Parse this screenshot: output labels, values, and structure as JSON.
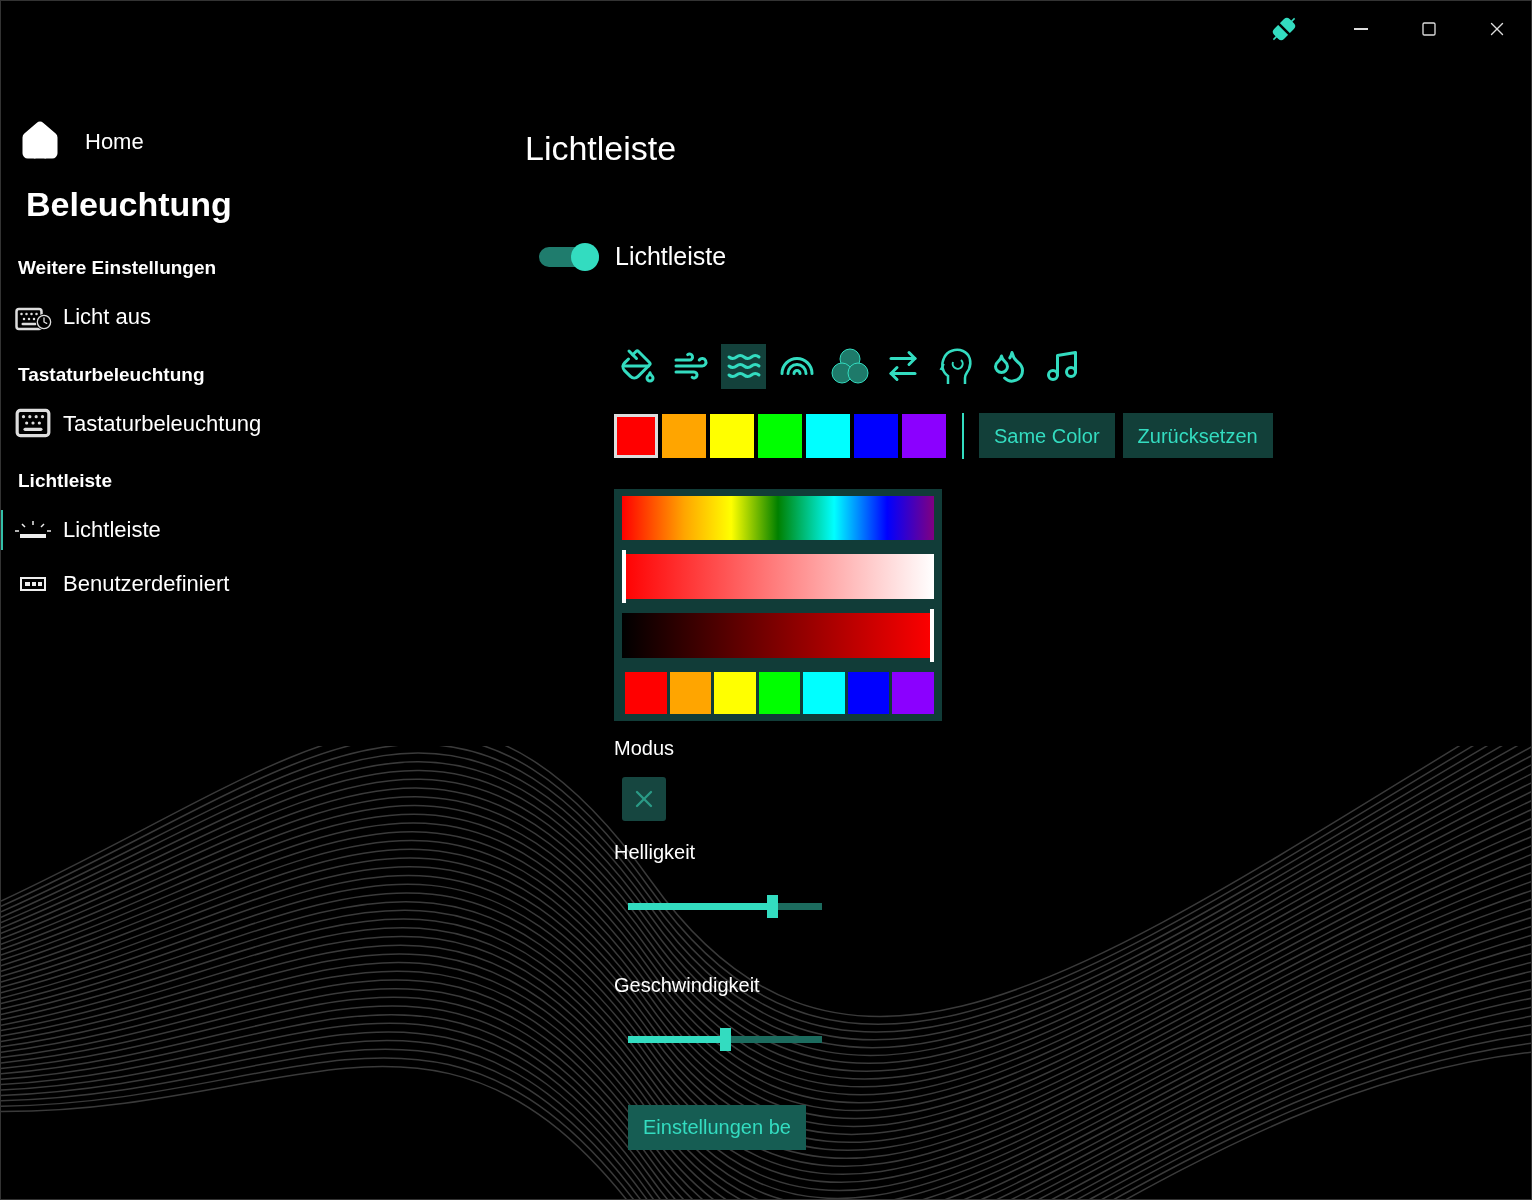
{
  "nav": {
    "home": "Home",
    "title": "Beleuchtung",
    "sections": [
      {
        "heading": "Weitere Einstellungen",
        "items": [
          {
            "label": "Licht aus",
            "kind": "timer",
            "selected": false
          }
        ]
      },
      {
        "heading": "Tastaturbeleuchtung",
        "items": [
          {
            "label": "Tastaturbeleuchtung",
            "kind": "keyboard",
            "selected": false
          }
        ]
      },
      {
        "heading": "Lichtleiste",
        "items": [
          {
            "label": "Lichtleiste",
            "kind": "lightbar",
            "selected": true
          },
          {
            "label": "Benutzerdefiniert",
            "kind": "custom",
            "selected": false
          }
        ]
      }
    ]
  },
  "page": {
    "title": "Lichtleiste",
    "toggle": {
      "label": "Lichtleiste",
      "on": true
    },
    "effects": [
      {
        "kind": "bucket",
        "selected": false
      },
      {
        "kind": "wind",
        "selected": false
      },
      {
        "kind": "wave",
        "selected": true
      },
      {
        "kind": "rainbow",
        "selected": false
      },
      {
        "kind": "circles",
        "selected": false
      },
      {
        "kind": "swap",
        "selected": false
      },
      {
        "kind": "head",
        "selected": false
      },
      {
        "kind": "drops",
        "selected": false
      },
      {
        "kind": "music",
        "selected": false
      }
    ],
    "swatches": [
      {
        "color": "#ff0000",
        "selected": true
      },
      {
        "color": "#ffa500",
        "selected": false
      },
      {
        "color": "#ffff00",
        "selected": false
      },
      {
        "color": "#00ff00",
        "selected": false
      },
      {
        "color": "#00ffff",
        "selected": false
      },
      {
        "color": "#0000ff",
        "selected": false
      },
      {
        "color": "#8b00ff",
        "selected": false
      }
    ],
    "buttons": [
      "Same Color",
      "Zurücksetzen"
    ],
    "picker": {
      "saturation": {
        "level": 0
      },
      "brightness": {
        "level": 1
      },
      "swatches": [
        {
          "color": "#ff0000"
        },
        {
          "color": "#ffa500"
        },
        {
          "color": "#ffff00"
        },
        {
          "color": "#00ff00"
        },
        {
          "color": "#00ffff"
        },
        {
          "color": "#0000ff"
        },
        {
          "color": "#8b00ff"
        }
      ]
    },
    "mode": {
      "label": "Modus"
    },
    "sliders": [
      {
        "label": "Helligkeit",
        "level": 0.74
      },
      {
        "label": "Geschwindigkeit",
        "level": 0.5
      }
    ],
    "apply": "Einstellungen be"
  }
}
